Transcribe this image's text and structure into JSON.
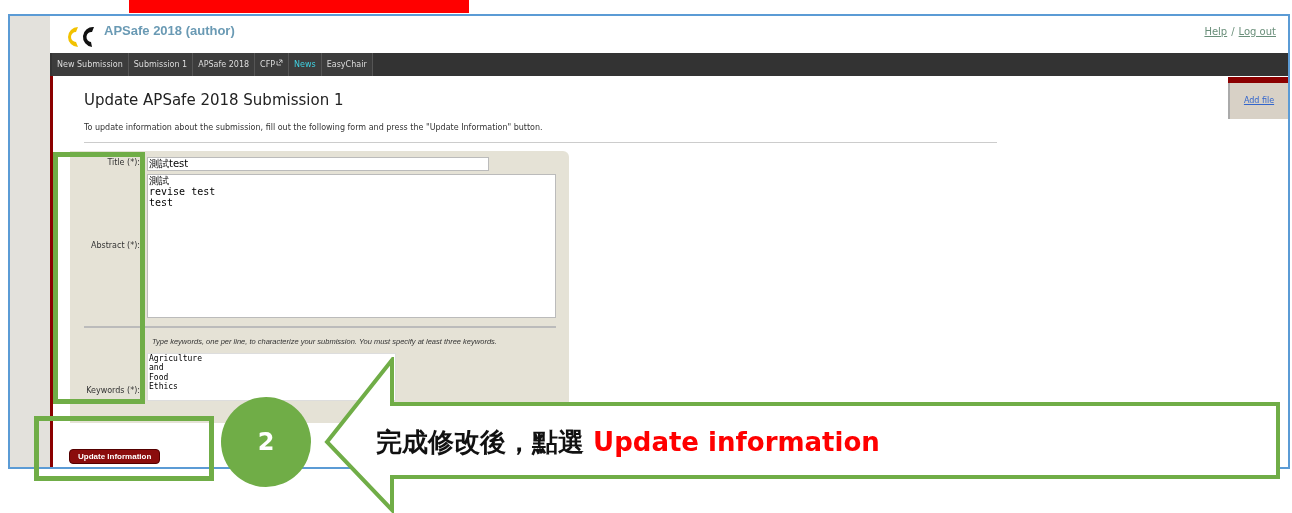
{
  "header": {
    "title": "APSafe 2018 (author)",
    "links": [
      "Help",
      "Log out"
    ],
    "separator": "/"
  },
  "nav": [
    {
      "label": "New Submission",
      "selected": false,
      "external": false
    },
    {
      "label": "Submission 1",
      "selected": false,
      "external": false
    },
    {
      "label": "APSafe 2018",
      "selected": false,
      "external": false
    },
    {
      "label": "CFP",
      "selected": false,
      "external": true
    },
    {
      "label": "News",
      "selected": true,
      "external": false
    },
    {
      "label": "EasyChair",
      "selected": false,
      "external": false
    }
  ],
  "side_tab": {
    "label": "Add file"
  },
  "page": {
    "heading": "Update APSafe 2018 Submission 1",
    "intro": "To update information about the submission, fill out the following form and press the \"Update Information\" button."
  },
  "form": {
    "title": {
      "label": "Title (*):",
      "value": "測試test"
    },
    "abstract": {
      "label": "Abstract (*):",
      "value": "測試\nrevise test\ntest"
    },
    "keywords_hint": "Type keywords, one per line, to characterize your submission. You must specify at least three keywords.",
    "keywords": {
      "label": "Keywords (*):",
      "value": "Agriculture\nand\nFood\nEthics"
    },
    "submit": "Update Information"
  },
  "annotation": {
    "step": "2",
    "text": "完成修改後，點選 ",
    "highlight": "Update information"
  }
}
